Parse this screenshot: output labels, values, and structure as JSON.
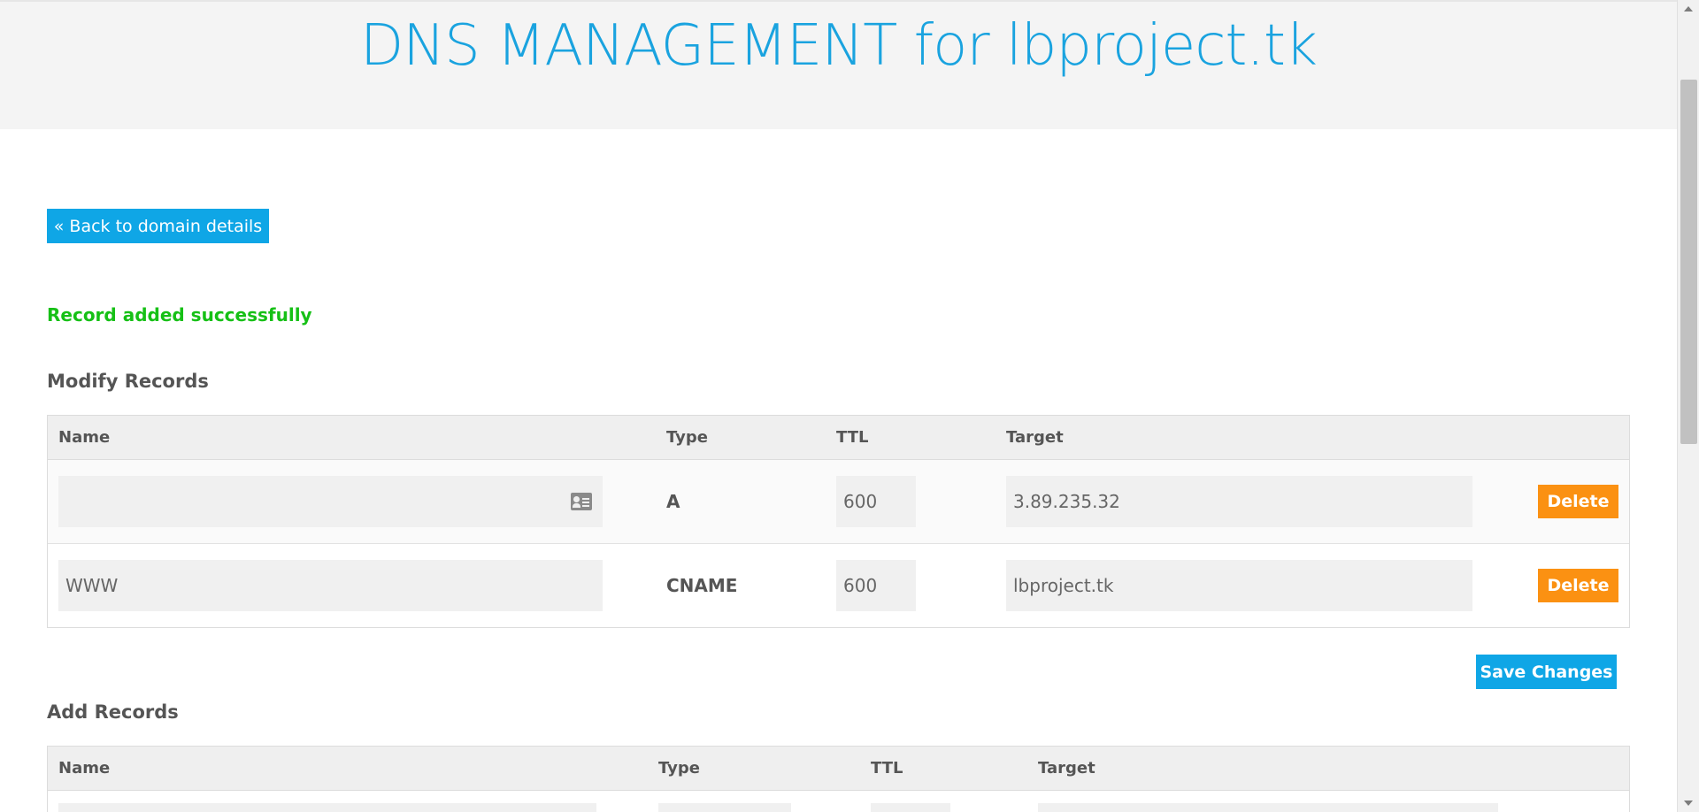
{
  "header": {
    "title": "DNS MANAGEMENT for lbproject.tk"
  },
  "nav": {
    "back_label": "« Back to domain details"
  },
  "status": {
    "message": "Record added successfully"
  },
  "modify": {
    "heading": "Modify Records",
    "columns": [
      "Name",
      "Type",
      "TTL",
      "Target"
    ],
    "rows": [
      {
        "name": "",
        "type": "A",
        "ttl": "600",
        "target": "3.89.235.32",
        "delete_label": "Delete"
      },
      {
        "name": "WWW",
        "type": "CNAME",
        "ttl": "600",
        "target": "lbproject.tk",
        "delete_label": "Delete"
      }
    ],
    "save_label": "Save Changes"
  },
  "add": {
    "heading": "Add Records",
    "columns": [
      "Name",
      "Type",
      "TTL",
      "Target"
    ]
  },
  "colors": {
    "title": "#1aa3df",
    "primary_button": "#0fa6e6",
    "delete_button": "#fb9112",
    "success": "#16c016"
  },
  "icons": {
    "name_field_icon": "contact-card-icon"
  }
}
